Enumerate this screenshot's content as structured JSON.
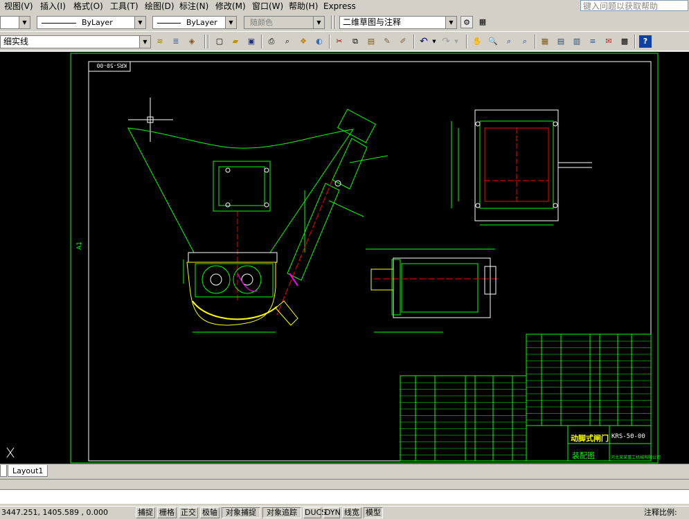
{
  "menu": {
    "items": [
      "视图(V)",
      "插入(I)",
      "格式(O)",
      "工具(T)",
      "绘图(D)",
      "标注(N)",
      "修改(M)",
      "窗口(W)",
      "帮助(H)",
      "Express"
    ],
    "help_placeholder": "键入问题以获取帮助"
  },
  "properties_toolbar": {
    "linetype_value": "ByLayer",
    "lineweight_value": "ByLayer",
    "plotstyle_value": "随颜色",
    "workspace_value": "二维草图与注释"
  },
  "layer_toolbar": {
    "layer_value": "细实线"
  },
  "drawing": {
    "title_block_code": "KRS-50-00",
    "title_block_name": "动脚式闸门",
    "title_block_type": "装配图",
    "title_block_company": "河北某某重工机械有限公司",
    "sheet_size": "A1",
    "corner_label": "KRS-50-00",
    "colors": {
      "frame": "#ffffff",
      "green": "#00ff00",
      "yellow": "#ffff00",
      "red": "#ff0000",
      "cyan": "#00ffff",
      "magenta": "#ff00ff"
    }
  },
  "tabs": {
    "items": [
      "Layout1"
    ]
  },
  "status": {
    "coords": "3447.251, 1405.589 , 0.000",
    "buttons": [
      "捕捉",
      "栅格",
      "正交",
      "极轴",
      "对象捕捉",
      "对象追踪",
      "DUCS",
      "DYN",
      "线宽",
      "模型"
    ],
    "scale_label": "注释比例:"
  }
}
